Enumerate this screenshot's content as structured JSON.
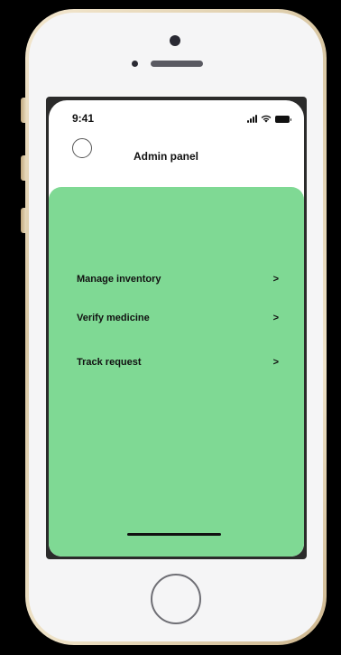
{
  "status_bar": {
    "time": "9:41"
  },
  "header": {
    "title": "Admin panel"
  },
  "menu": {
    "items": [
      {
        "label": "Manage inventory",
        "chevron": ">"
      },
      {
        "label": "Verify medicine",
        "chevron": ">"
      },
      {
        "label": "Track request",
        "chevron": ">"
      }
    ]
  },
  "colors": {
    "panel_background": "#7fd994",
    "screen_background": "#ffffff",
    "text": "#111111"
  },
  "icons": {
    "avatar": "avatar-circle-icon",
    "signal": "cellular-signal-icon",
    "wifi": "wifi-icon",
    "battery": "battery-icon"
  }
}
